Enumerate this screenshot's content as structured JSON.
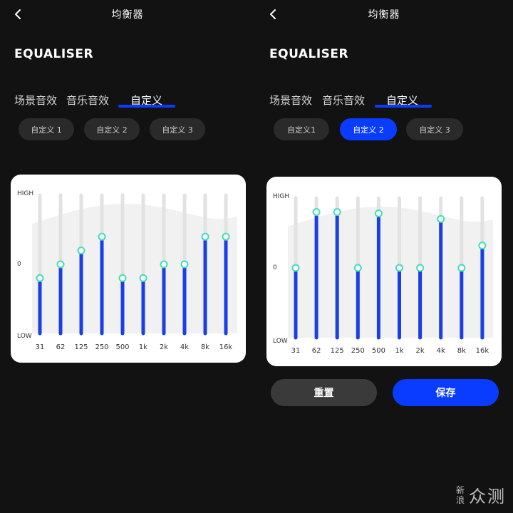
{
  "watermark": {
    "small_top": "新",
    "small_bottom": "浪",
    "big": "众测"
  },
  "screens": [
    {
      "title": "均衡器",
      "heading": "EQUALISER",
      "tabs": [
        "场景音效",
        "音乐音效",
        "自定义"
      ],
      "active_tab": 2,
      "presets": [
        "自定义 1",
        "自定义 2",
        "自定义 3"
      ],
      "active_preset": 0,
      "y_labels": {
        "high": "HIGH",
        "zero": "0",
        "low": "LOW"
      },
      "eq_bands": [
        {
          "label": "31",
          "level": 0.4
        },
        {
          "label": "62",
          "level": 0.5
        },
        {
          "label": "125",
          "level": 0.6
        },
        {
          "label": "250",
          "level": 0.7
        },
        {
          "label": "500",
          "level": 0.4
        },
        {
          "label": "1k",
          "level": 0.4
        },
        {
          "label": "2k",
          "level": 0.5
        },
        {
          "label": "4k",
          "level": 0.5
        },
        {
          "label": "8k",
          "level": 0.7
        },
        {
          "label": "16k",
          "level": 0.7
        }
      ]
    },
    {
      "title": "均衡器",
      "heading": "EQUALISER",
      "tabs": [
        "场景音效",
        "音乐音效",
        "自定义"
      ],
      "active_tab": 2,
      "presets": [
        "自定义1",
        "自定义 2",
        "自定义 3"
      ],
      "active_preset": 1,
      "y_labels": {
        "high": "HIGH",
        "zero": "0",
        "low": "LOW"
      },
      "eq_bands": [
        {
          "label": "31",
          "level": 0.5
        },
        {
          "label": "62",
          "level": 0.9
        },
        {
          "label": "125",
          "level": 0.9
        },
        {
          "label": "250",
          "level": 0.5
        },
        {
          "label": "500",
          "level": 0.89
        },
        {
          "label": "1k",
          "level": 0.5
        },
        {
          "label": "2k",
          "level": 0.5
        },
        {
          "label": "4k",
          "level": 0.85
        },
        {
          "label": "8k",
          "level": 0.5
        },
        {
          "label": "16k",
          "level": 0.66
        }
      ],
      "buttons": {
        "reset_label": "重置",
        "save_label": "保存"
      }
    }
  ]
}
